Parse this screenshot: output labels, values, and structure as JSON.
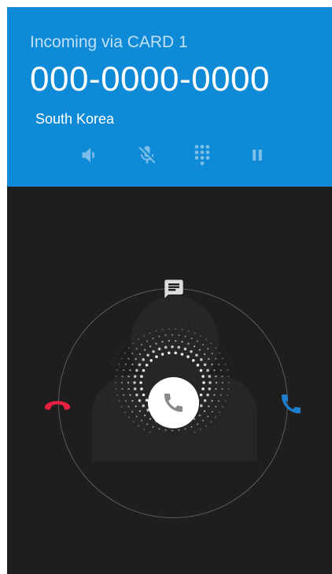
{
  "header": {
    "via_label": "Incoming via CARD 1",
    "phone_number": "000-0000-0000",
    "location": "South Korea"
  },
  "controls": [
    {
      "icon": "speaker-icon"
    },
    {
      "icon": "mute-icon"
    },
    {
      "icon": "dialpad-icon"
    },
    {
      "icon": "pause-icon"
    }
  ],
  "actions": {
    "sms_icon": "message-icon",
    "decline_icon": "decline-phone-icon",
    "accept_icon": "accept-phone-icon",
    "answer_handle_icon": "phone-icon"
  },
  "colors": {
    "header_bg": "#0f8ad6",
    "screen_bg": "#1e1e1e",
    "decline": "#e8203f",
    "accept": "#1e7fd0",
    "control_icon": "#ffffff"
  }
}
